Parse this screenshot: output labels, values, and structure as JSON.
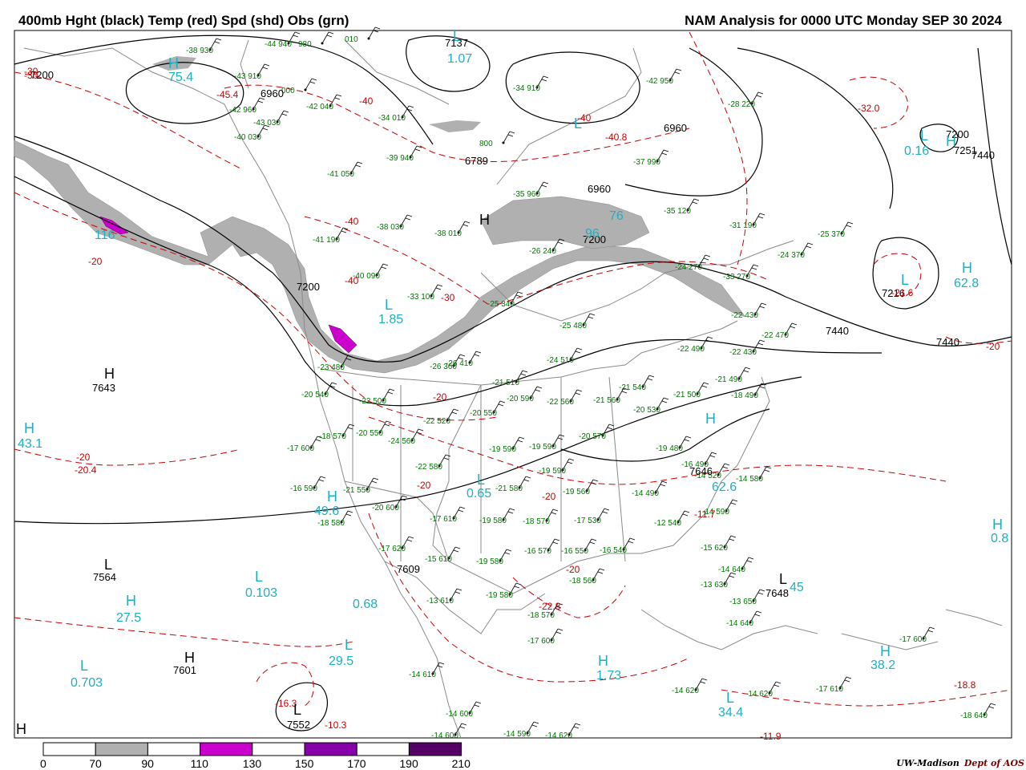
{
  "title_left": "400mb Hght (black) Temp (red) Spd (shd) Obs (grn)",
  "title_right": "NAM Analysis for 0000 UTC Monday  SEP 30 2024",
  "credit": {
    "org": "UW-Madison",
    "dept": "Dept of AOS"
  },
  "colors": {
    "height": "#000000",
    "temp": "#cc0000",
    "obs": "#007700",
    "speed_label": "#1ab1c4",
    "shade_70": "#b0b0b0",
    "shade_110": "#cc00cc",
    "shade_150": "#8800aa",
    "shade_190": "#550066",
    "borders": "#8a8a8a"
  },
  "legend": {
    "labels": [
      "0",
      "70",
      "90",
      "110",
      "130",
      "150",
      "170",
      "190",
      "210"
    ],
    "colors": [
      "#ffffff",
      "#b0b0b0",
      "#ffffff",
      "#cc00cc",
      "#ffffff",
      "#8800aa",
      "#ffffff",
      "#550066",
      "#ffffff"
    ]
  },
  "height_labels": [
    "7200",
    "6960",
    "7137",
    "6789",
    "6960",
    "6960",
    "7200",
    "7200",
    "7251",
    "7440",
    "7216",
    "7440",
    "7440",
    "7643",
    "7564",
    "7601",
    "7552",
    "7609",
    "7646",
    "7648",
    "7200"
  ],
  "temp_labels": [
    "-30",
    "-40",
    "-45.4",
    "-40",
    "-40.8",
    "-40",
    "-20",
    "-40",
    "-30",
    "-20",
    "-20.4",
    "-20",
    "-20",
    "-20",
    "-32.0",
    "-21.6",
    "-20",
    "-22.8",
    "-16.3",
    "-10.3",
    "-18.8",
    "-11.9",
    "-11.7",
    "-20",
    "-30"
  ],
  "speed_labels": [
    "75.4",
    "1.07",
    "0.16",
    "116",
    "96",
    "1.85",
    "62.8",
    "43.1",
    "49.6",
    "0.65",
    "62.6",
    "0.103",
    "27.5",
    "0.703",
    "29.5",
    "1.73",
    "34.4",
    "38.2",
    "0.8",
    "0.68",
    "76",
    "45"
  ],
  "hl_letters": [
    "H",
    "L",
    "L",
    "L",
    "H",
    "L",
    "H",
    "L",
    "H",
    "H",
    "L",
    "H",
    "L",
    "H",
    "L",
    "L",
    "H",
    "L",
    "H",
    "H",
    "L",
    "L",
    "L",
    "H",
    "H",
    "H",
    "H"
  ],
  "obs": [
    "-38 930",
    "-44 940",
    "980",
    "010",
    "-43 910",
    "000",
    "-42 040",
    "-43 030",
    "-42 960",
    "-40 030",
    "-34 010",
    "-34 910",
    "800",
    "-37 990",
    "-39 940",
    "-28 220",
    "-42 950",
    "-41 050",
    "-31 190",
    "-35 120",
    "-38 030",
    "-38 010",
    "-33 100",
    "-25 370",
    "-24 370",
    "-35 960",
    "-26 240",
    "-24 270",
    "-33 270",
    "-41 190",
    "-40 090",
    "-25 340",
    "-25 480",
    "-22 430",
    "-24 510",
    "-22 490",
    "-22 470",
    "-22 430",
    "-21 490",
    "-18 490",
    "-21 510",
    "-20 590",
    "-22 560",
    "-21 560",
    "-21 540",
    "-21 500",
    "-20 530",
    "-26 360",
    "-26 410",
    "-23 480",
    "-22 500",
    "-20 540",
    "-22 520",
    "-20 550",
    "-18 570",
    "-20 550",
    "-24 560",
    "-17 600",
    "-20 570",
    "-19 480",
    "-19 590",
    "-19 590",
    "-22 580",
    "-21 580",
    "-19 590",
    "-19 560",
    "-16 490",
    "-14 520",
    "-14 580",
    "-16 590",
    "-21 550",
    "-20 600",
    "-17 610",
    "-19 580",
    "-18 570",
    "-17 530",
    "-12 540",
    "-14 590",
    "-14 490",
    "-18 580",
    "-17 620",
    "-15 610",
    "-19 580",
    "-16 570",
    "-16 550",
    "-16 540",
    "-15 620",
    "-14 640",
    "-13 630",
    "-13 650",
    "-14 640",
    "-13 610",
    "-19 580",
    "-18 570",
    "-18 560",
    "-17 600",
    "-14 610",
    "-14 620",
    "-14 620",
    "-17 610",
    "-17 600",
    "-18 640",
    "-14 600",
    "-14 600",
    "-14 590",
    "-14 620"
  ]
}
